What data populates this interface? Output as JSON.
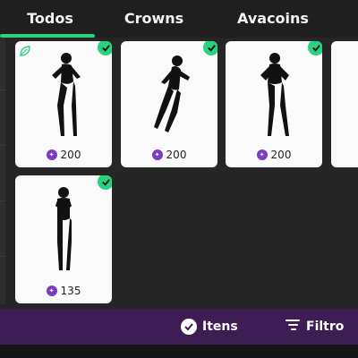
{
  "tabs": {
    "todos": "Todos",
    "crowns": "Crowns",
    "avacoins": "Avacoins"
  },
  "items": [
    {
      "price": "200",
      "owned": true,
      "has_leaf_icon": true
    },
    {
      "price": "200",
      "owned": true
    },
    {
      "price": "200",
      "owned": true
    },
    {
      "price": "",
      "owned": false
    },
    {
      "price": "135",
      "owned": true
    }
  ],
  "bottom_bar": {
    "itens_label": "Itens",
    "filtro_label": "Filtro"
  },
  "colors": {
    "accent": "#2ad17e",
    "bottom_bar": "#3e1d55",
    "coin": "#7a3cc1"
  }
}
